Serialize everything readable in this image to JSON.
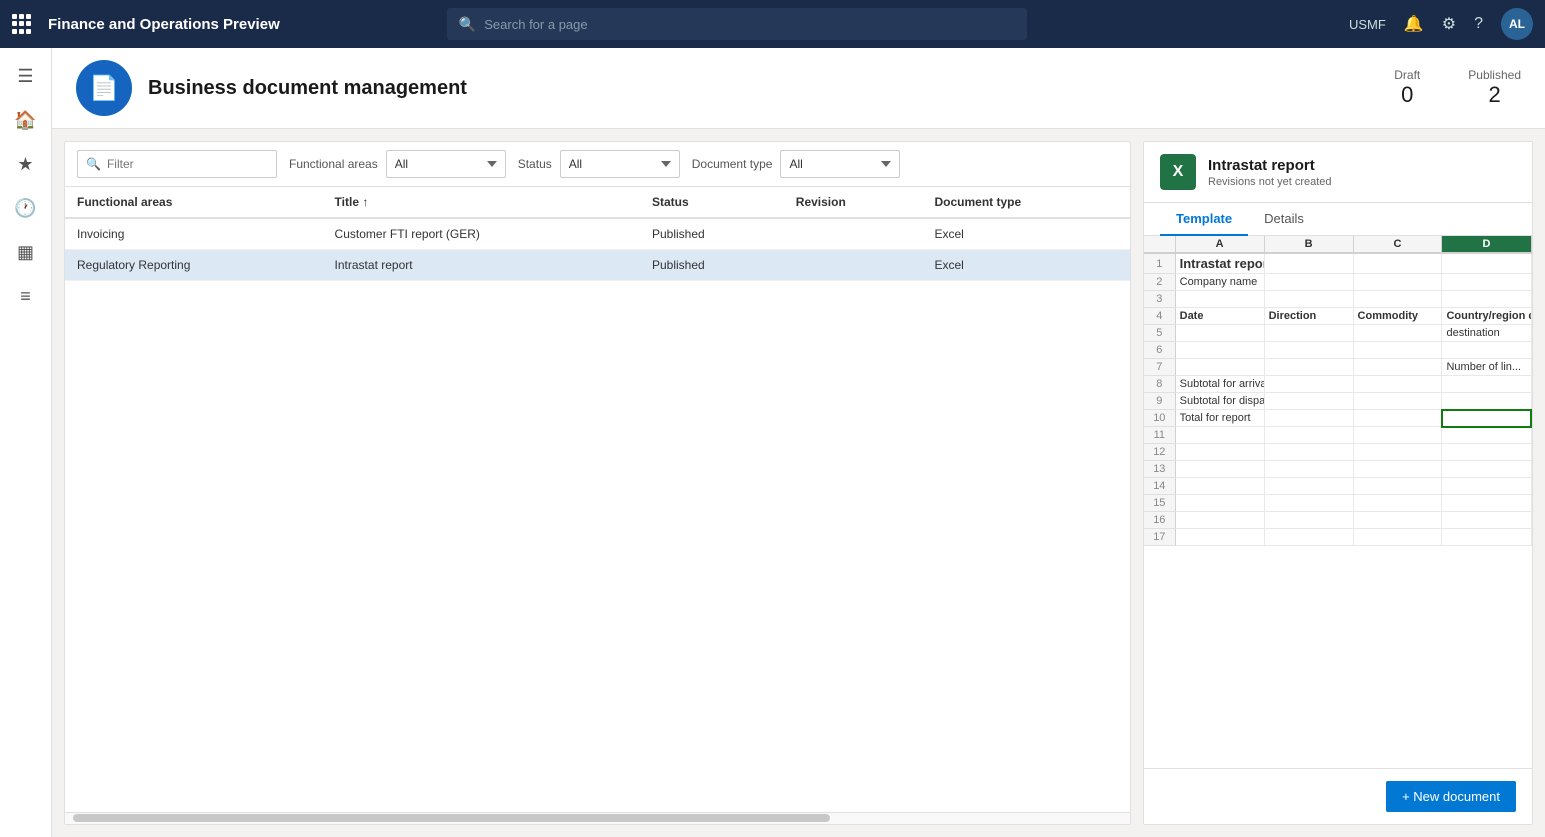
{
  "topnav": {
    "app_title": "Finance and Operations Preview",
    "search_placeholder": "Search for a page",
    "company": "USMF",
    "user_initials": "AL"
  },
  "page": {
    "title": "Business document management",
    "draft_label": "Draft",
    "draft_count": "0",
    "published_label": "Published",
    "published_count": "2"
  },
  "filters": {
    "filter_placeholder": "Filter",
    "functional_areas_label": "Functional areas",
    "functional_areas_value": "All",
    "status_label": "Status",
    "status_value": "All",
    "document_type_label": "Document type",
    "document_type_value": "All"
  },
  "table": {
    "columns": [
      "Functional areas",
      "Title",
      "Status",
      "Revision",
      "Document type"
    ],
    "rows": [
      {
        "functional_area": "Invoicing",
        "title": "Customer FTI report (GER)",
        "status": "Published",
        "revision": "",
        "document_type": "Excel",
        "selected": false
      },
      {
        "functional_area": "Regulatory Reporting",
        "title": "Intrastat report",
        "status": "Published",
        "revision": "",
        "document_type": "Excel",
        "selected": true
      }
    ]
  },
  "right_panel": {
    "title": "Intrastat report",
    "subtitle": "Revisions not yet created",
    "tabs": [
      "Template",
      "Details"
    ],
    "active_tab": "Template",
    "new_doc_label": "+ New document",
    "spreadsheet": {
      "columns": [
        "",
        "A",
        "B",
        "C",
        "D"
      ],
      "rows": [
        {
          "num": "1",
          "cells": [
            "Intrastat report",
            "",
            "",
            ""
          ]
        },
        {
          "num": "2",
          "cells": [
            "Company name",
            "",
            "",
            ""
          ]
        },
        {
          "num": "3",
          "cells": [
            "",
            "",
            "",
            ""
          ]
        },
        {
          "num": "4",
          "cells": [
            "Date",
            "Direction",
            "Commodity",
            "Country/region c..."
          ]
        },
        {
          "num": "5",
          "cells": [
            "",
            "",
            "",
            "destination"
          ]
        },
        {
          "num": "6",
          "cells": [
            "",
            "",
            "",
            ""
          ]
        },
        {
          "num": "7",
          "cells": [
            "",
            "",
            "",
            "Number of lin..."
          ]
        },
        {
          "num": "8",
          "cells": [
            "Subtotal for arrivals",
            "",
            "",
            ""
          ]
        },
        {
          "num": "9",
          "cells": [
            "Subtotal for dispatches",
            "",
            "",
            ""
          ]
        },
        {
          "num": "10",
          "cells": [
            "Total for report",
            "",
            "",
            ""
          ]
        },
        {
          "num": "11",
          "cells": [
            "",
            "",
            "",
            ""
          ]
        },
        {
          "num": "12",
          "cells": [
            "",
            "",
            "",
            ""
          ]
        },
        {
          "num": "13",
          "cells": [
            "",
            "",
            "",
            ""
          ]
        },
        {
          "num": "14",
          "cells": [
            "",
            "",
            "",
            ""
          ]
        },
        {
          "num": "15",
          "cells": [
            "",
            "",
            "",
            ""
          ]
        },
        {
          "num": "16",
          "cells": [
            "",
            "",
            "",
            ""
          ]
        },
        {
          "num": "17",
          "cells": [
            "",
            "",
            "",
            ""
          ]
        }
      ]
    }
  }
}
